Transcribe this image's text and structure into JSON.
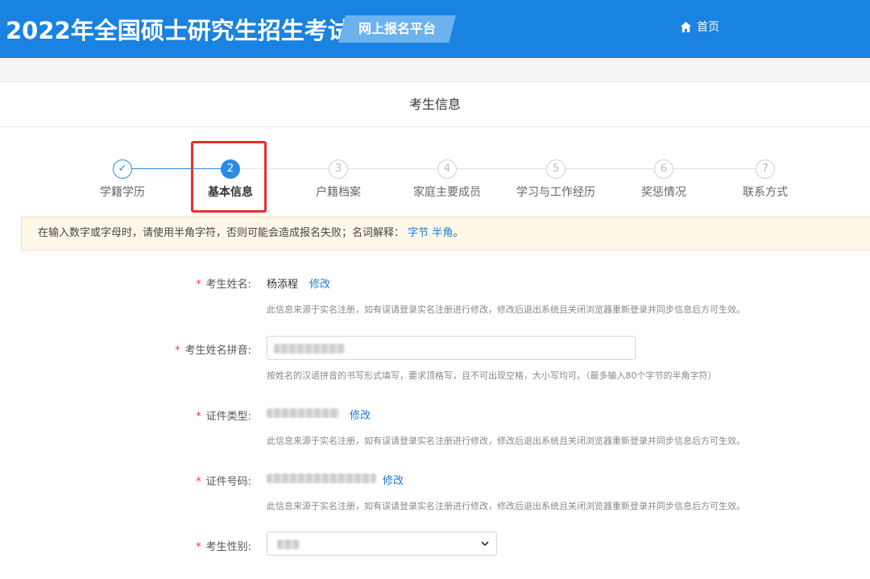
{
  "header": {
    "title": "2022年全国硕士研究生招生考试",
    "platform": "网上报名平台",
    "home": "首页",
    "home_icon": "home-icon"
  },
  "section": {
    "title": "考生信息"
  },
  "steps": [
    {
      "num": "✓",
      "label": "学籍学历",
      "state": "done"
    },
    {
      "num": "2",
      "label": "基本信息",
      "state": "active"
    },
    {
      "num": "3",
      "label": "户籍档案",
      "state": "todo"
    },
    {
      "num": "4",
      "label": "家庭主要成员",
      "state": "todo"
    },
    {
      "num": "5",
      "label": "学习与工作经历",
      "state": "todo"
    },
    {
      "num": "6",
      "label": "奖惩情况",
      "state": "todo"
    },
    {
      "num": "7",
      "label": "联系方式",
      "state": "todo"
    }
  ],
  "notice": {
    "text": "在输入数字或字母时，请使用半角字符，否则可能会造成报名失败；名词解释：",
    "link_byte": "字节",
    "link_halfwidth": "半角",
    "end": "。"
  },
  "form": {
    "name": {
      "label": "考生姓名:",
      "value": "杨添程",
      "edit": "修改",
      "hint": "此信息来源于实名注册，如有误请登录实名注册进行修改，修改后退出系统且关闭浏览器重新登录并同步信息后方可生效。"
    },
    "pinyin": {
      "label": "考生姓名拼音:",
      "hint": "按姓名的汉语拼音的书写形式填写，要求顶格写，且不可出现空格，大小写均可。（最多输入80个字节的半角字符）"
    },
    "id_type": {
      "label": "证件类型:",
      "edit": "修改",
      "hint": "此信息来源于实名注册，如有误请登录实名注册进行修改，修改后退出系统且关闭浏览器重新登录并同步信息后方可生效。"
    },
    "id_number": {
      "label": "证件号码:",
      "edit": "修改",
      "hint": "此信息来源于实名注册，如有误请登录实名注册进行修改，修改后退出系统且关闭浏览器重新登录并同步信息后方可生效。"
    },
    "gender": {
      "label": "考生性别:"
    }
  },
  "colors": {
    "header": "#1a82e0",
    "accent": "#2a8be3",
    "highlight": "#e8302b",
    "required": "#e4393c"
  }
}
